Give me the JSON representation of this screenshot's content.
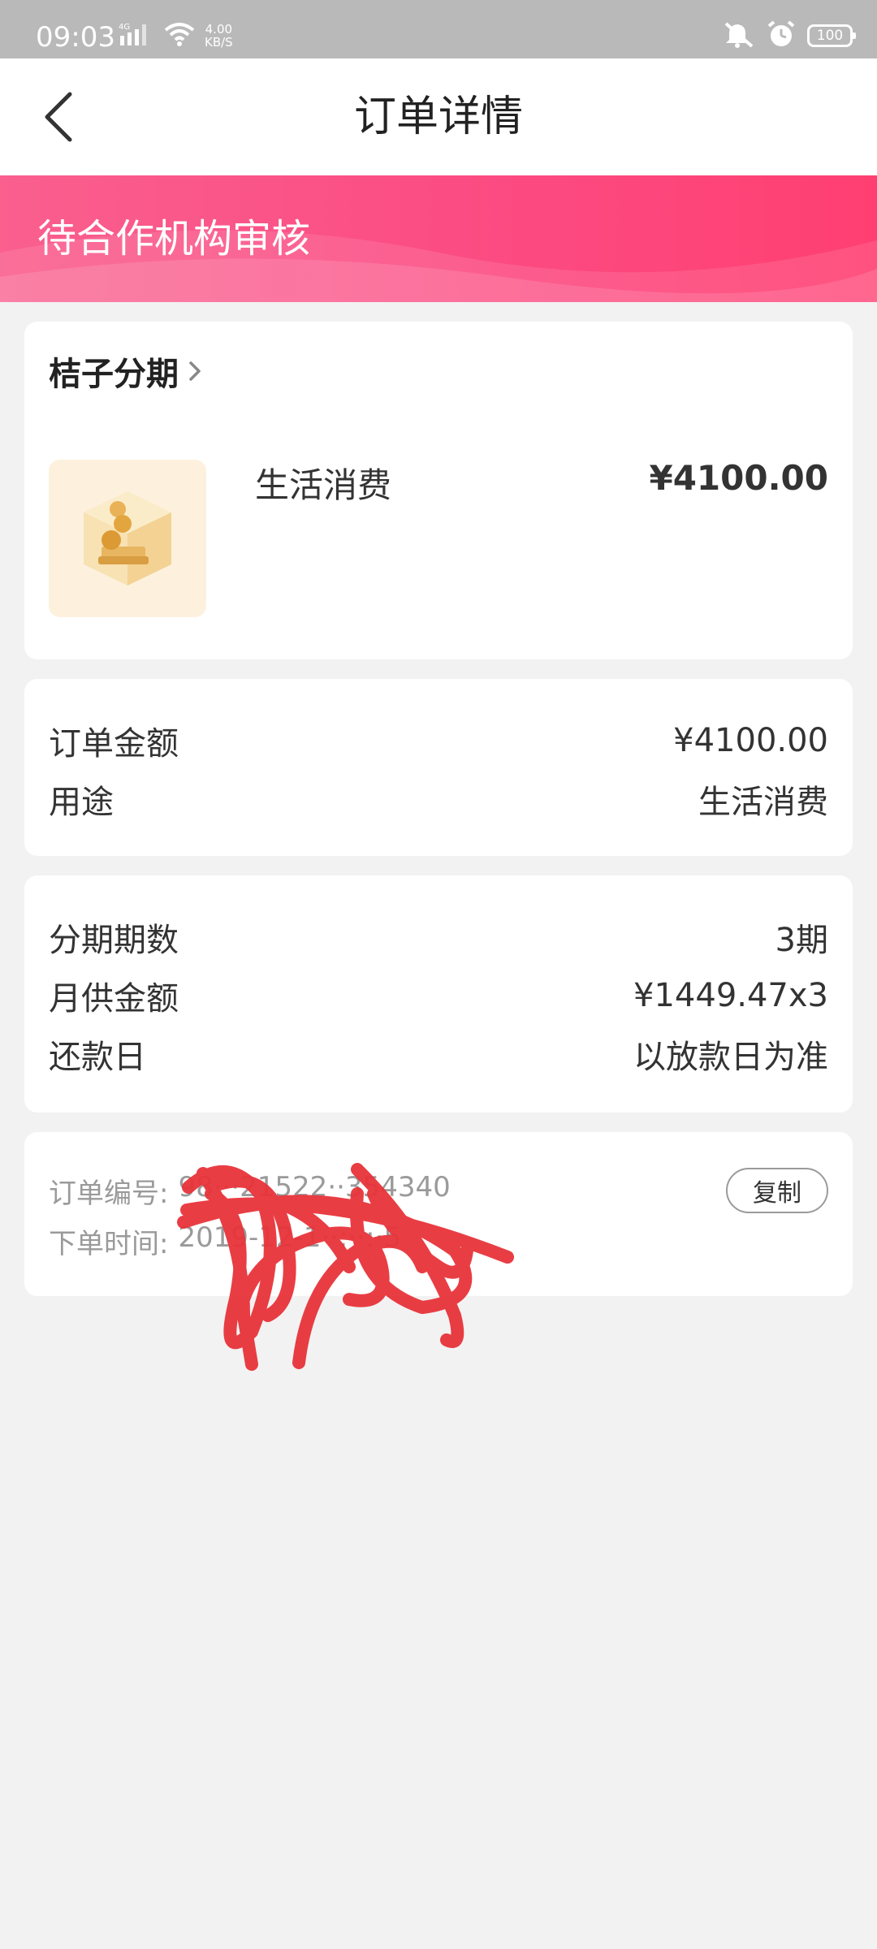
{
  "status_bar": {
    "time": "09:03",
    "network_type": "4G",
    "speed_value": "4.00",
    "speed_unit": "KB/S",
    "battery": "100"
  },
  "header": {
    "title": "订单详情"
  },
  "banner": {
    "status": "待合作机构审核"
  },
  "product_card": {
    "merchant": "桔子分期",
    "product_name": "生活消费",
    "price": "¥4100.00"
  },
  "amount_card": {
    "rows": [
      {
        "label": "订单金额",
        "value": "¥4100.00"
      },
      {
        "label": "用途",
        "value": "生活消费"
      }
    ]
  },
  "installment_card": {
    "rows": [
      {
        "label": "分期期数",
        "value": "3期"
      },
      {
        "label": "月供金额",
        "value": "¥1449.47x3"
      },
      {
        "label": "还款日",
        "value": "以放款日为准"
      }
    ]
  },
  "order_card": {
    "order_no_label": "订单编号:",
    "order_no_value": "98···21522··354340",
    "order_time_label": "下单时间:",
    "order_time_value": "2019-12-1··:··:·5",
    "copy_label": "复制"
  },
  "colors": {
    "banner_start": "#fa5f8e",
    "banner_end": "#ff3f72",
    "scribble": "#e8333a",
    "background": "#f2f2f2"
  }
}
